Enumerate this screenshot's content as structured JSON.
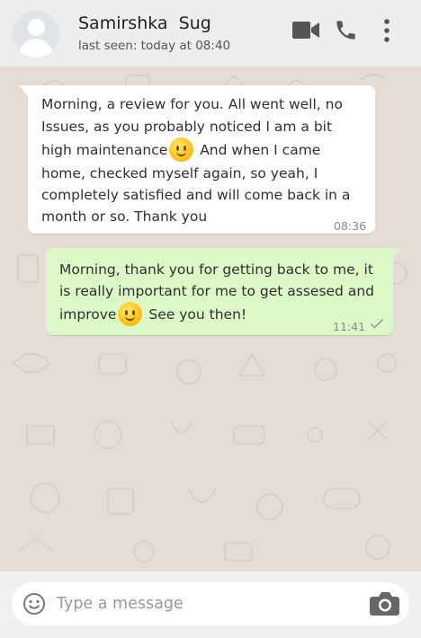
{
  "header": {
    "contact_name": "Samirshka  Sug",
    "last_seen": "last seen: today at 08:40",
    "icons": [
      "avatar",
      "video-call-icon",
      "phone-icon",
      "more-vertical-icon"
    ]
  },
  "messages": [
    {
      "direction": "incoming",
      "lines": [
        "Morning, a review for you. All went well, no",
        "Issues, as you probably noticed I am a bit",
        "high maintenance",
        " And when I came",
        "home, checked myself again, so yeah, I",
        "completely satisfied and will come back in a",
        "month or so. Thank you"
      ],
      "emoji": "slightly-smiling-face-emoji",
      "time": "08:36"
    },
    {
      "direction": "outgoing",
      "lines": [
        "Morning, thank you for getting back to me, it",
        "is really important for me to get assesed and",
        "improve",
        " See you then!"
      ],
      "emoji": "slightly-smiling-face-emoji",
      "time": "11:41",
      "status_icon": "check-icon"
    }
  ],
  "composer": {
    "placeholder": "Type a message",
    "icons": [
      "emoji-icon",
      "camera-icon"
    ]
  },
  "colors": {
    "header_bg": "#ededed",
    "chat_bg": "#e5ddd5",
    "incoming_bubble": "#ffffff",
    "outgoing_bubble": "#dcf8c6",
    "icon_gray": "#555555"
  }
}
